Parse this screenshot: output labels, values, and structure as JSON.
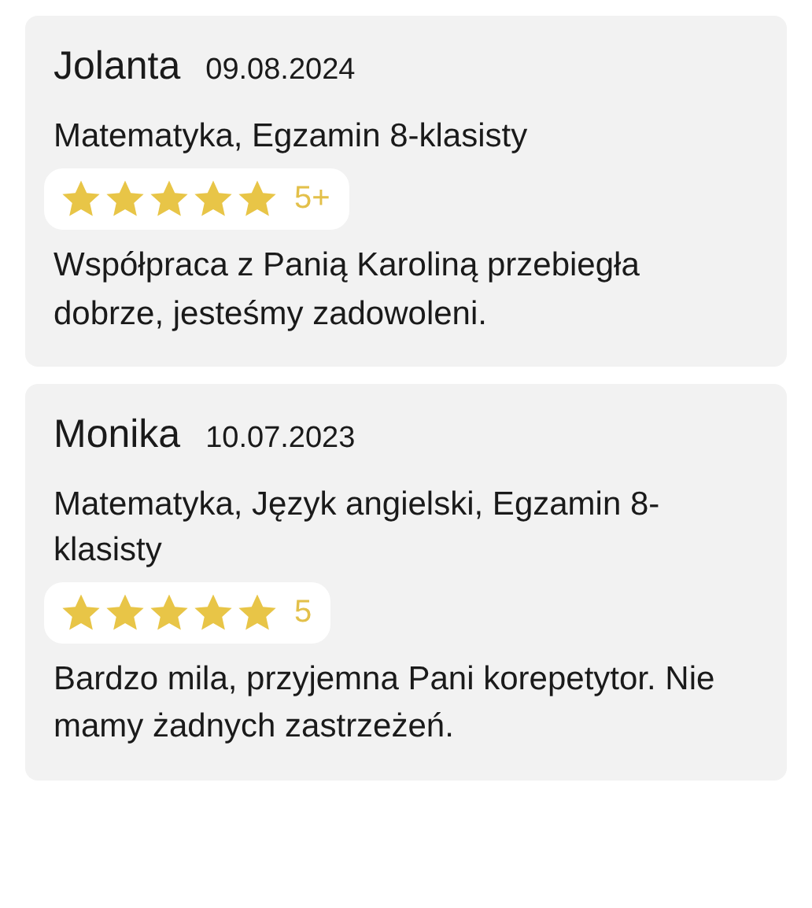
{
  "reviews": [
    {
      "author": "Jolanta",
      "date": "09.08.2024",
      "subjects": "Matematyka, Egzamin 8-klasisty",
      "stars": 5,
      "grade": "5+",
      "text": "Współpraca z Panią Karoliną przebiegła dobrze, jesteśmy zadowoleni."
    },
    {
      "author": "Monika",
      "date": "10.07.2023",
      "subjects": "Matematyka, Język angielski, Egzamin 8-klasisty",
      "stars": 5,
      "grade": "5",
      "text": "Bardzo mila, przyjemna Pani korepetytor. Nie mamy żadnych zastrzeżeń."
    }
  ]
}
